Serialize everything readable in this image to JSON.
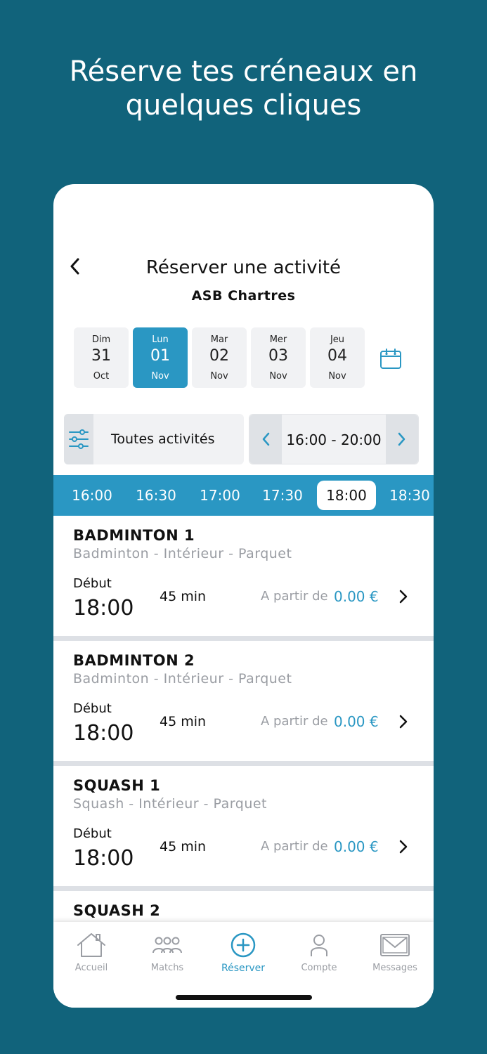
{
  "headline": {
    "line1": "Réserve tes créneaux en",
    "line2": "quelques cliques"
  },
  "header": {
    "title": "Réserver une activité",
    "subtitle": "ASB Chartres"
  },
  "dates": [
    {
      "dow": "Dim",
      "day": "31",
      "month": "Oct",
      "selected": false
    },
    {
      "dow": "Lun",
      "day": "01",
      "month": "Nov",
      "selected": true
    },
    {
      "dow": "Mar",
      "day": "02",
      "month": "Nov",
      "selected": false
    },
    {
      "dow": "Mer",
      "day": "03",
      "month": "Nov",
      "selected": false
    },
    {
      "dow": "Jeu",
      "day": "04",
      "month": "Nov",
      "selected": false
    }
  ],
  "filter": {
    "label": "Toutes activités"
  },
  "time_range": {
    "label": "16:00 - 20:00"
  },
  "time_slots": [
    "16:00",
    "16:30",
    "17:00",
    "17:30",
    "18:00",
    "18:30"
  ],
  "selected_slot": "18:00",
  "activities": [
    {
      "name": "BADMINTON 1",
      "description": "Badminton - Intérieur  - Parquet",
      "start_label": "Début",
      "start_time": "18:00",
      "duration": "45 min",
      "price_prefix": "A partir de",
      "price": "0.00 €"
    },
    {
      "name": "BADMINTON 2",
      "description": "Badminton - Intérieur  - Parquet",
      "start_label": "Début",
      "start_time": "18:00",
      "duration": "45 min",
      "price_prefix": "A partir de",
      "price": "0.00 €"
    },
    {
      "name": "SQUASH 1",
      "description": "Squash - Intérieur  - Parquet",
      "start_label": "Début",
      "start_time": "18:00",
      "duration": "45 min",
      "price_prefix": "A partir de",
      "price": "0.00 €"
    },
    {
      "name": "SQUASH 2"
    }
  ],
  "tabbar": {
    "items": [
      {
        "label": "Accueil",
        "icon": "home-icon"
      },
      {
        "label": "Matchs",
        "icon": "people-icon"
      },
      {
        "label": "Réserver",
        "icon": "plus-circle-icon",
        "active": true
      },
      {
        "label": "Compte",
        "icon": "user-icon"
      },
      {
        "label": "Messages",
        "icon": "mail-icon"
      }
    ]
  },
  "colors": {
    "background": "#11637b",
    "accent": "#2a97c3",
    "muted": "#9a9da3"
  }
}
